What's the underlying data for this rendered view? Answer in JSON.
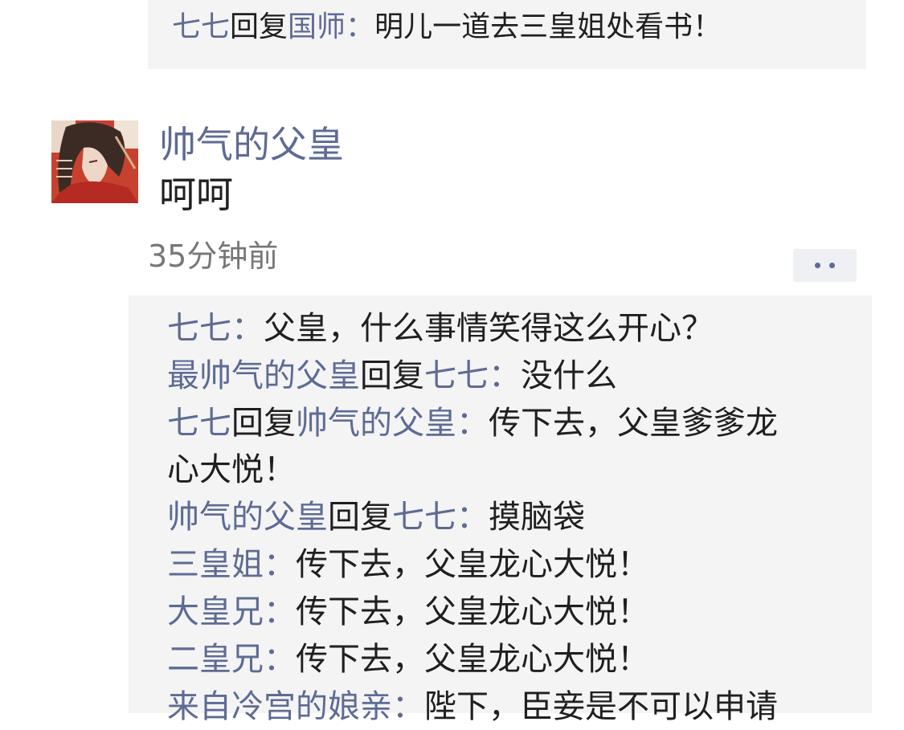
{
  "previous_comment": {
    "from": "七七",
    "reply_word": "回复",
    "to": "国师",
    "separator": "：",
    "text": "明儿一道去三皇姐处看书！"
  },
  "post": {
    "author": "帅气的父皇",
    "content": "呵呵",
    "time": "35分钟前"
  },
  "comments": {
    "c1": {
      "from": "七七",
      "separator": "：",
      "text": "父皇，什么事情笑得这么开心？"
    },
    "c2": {
      "from": "最帅气的父皇",
      "reply_word": "回复",
      "to": "七七",
      "separator": "：",
      "text": "没什么"
    },
    "c3": {
      "from": "七七",
      "reply_word": "回复",
      "to": "帅气的父皇",
      "separator": "：",
      "text": "传下去，父皇爹爹龙",
      "text_cont": "心大悦！"
    },
    "c4": {
      "from": "帅气的父皇",
      "reply_word": "回复",
      "to": "七七",
      "separator": "：",
      "text": "摸脑袋"
    },
    "c5": {
      "from": "三皇姐",
      "separator": "：",
      "text": "传下去，父皇龙心大悦！"
    },
    "c6": {
      "from": "大皇兄",
      "separator": "：",
      "text": "传下去，父皇龙心大悦！"
    },
    "c7": {
      "from": "二皇兄",
      "separator": "：",
      "text": "传下去，父皇龙心大悦！"
    },
    "c8": {
      "from": "来自冷宫的娘亲",
      "separator": "：",
      "text": "陛下，臣妾是不可以申请"
    }
  },
  "icons": {
    "more": "more-dots-icon",
    "avatar": "avatar-image"
  },
  "colors": {
    "name_link": "#5e6b93",
    "text": "#1f1f1f",
    "time": "#777777",
    "comment_bg": "#f4f4f5"
  }
}
